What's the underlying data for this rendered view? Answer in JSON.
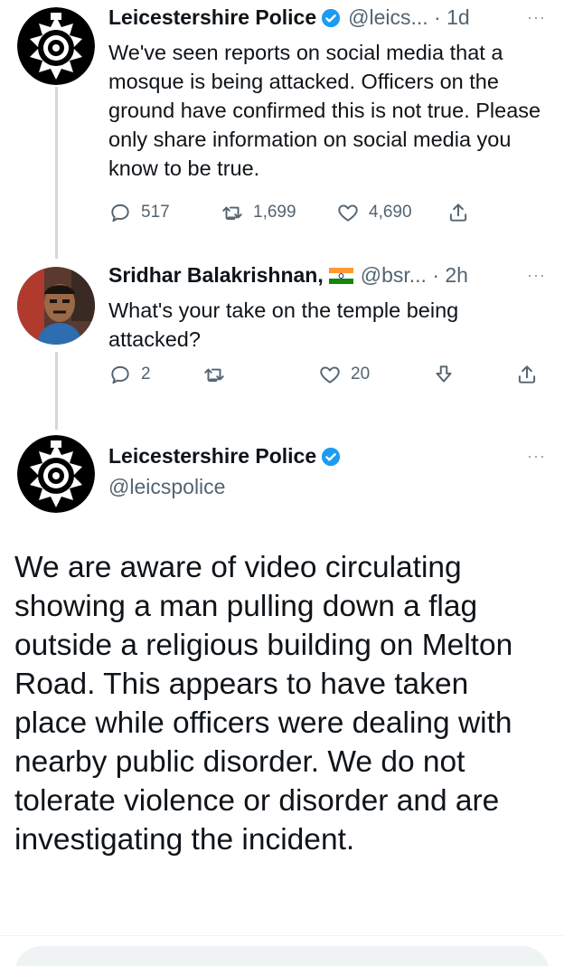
{
  "tweets": [
    {
      "name": "Leicestershire Police",
      "handle": "@leics... · 1d",
      "more": "···",
      "text": "We've seen reports on social media that a mosque is being attacked. Officers on the ground have confirmed this is not true. Please only share information on social media you know to be true.",
      "replies": "517",
      "retweets": "1,699",
      "likes": "4,690"
    },
    {
      "name": "Sridhar Balakrishnan,",
      "handle": "@bsr... · 2h",
      "more": "···",
      "text": "What's your take on the temple being attacked?",
      "replies": "2",
      "retweets": "",
      "likes": "20"
    }
  ],
  "main": {
    "name": "Leicestershire Police",
    "handle": "@leicspolice",
    "more": "···",
    "text": "We are aware of video circulating showing a man pulling down a flag outside a religious building on Melton Road. This appears to have taken place while officers were dealing with nearby public disorder. We do not tolerate violence or disorder and are investigating the incident."
  },
  "icons": {
    "verified": "verified-badge-icon",
    "reply": "reply-icon",
    "retweet": "retweet-icon",
    "like": "heart-icon",
    "share": "share-icon",
    "downvote": "downvote-icon",
    "flag": "india-flag-icon"
  },
  "colors": {
    "verified": "#1d9bf0",
    "text": "#0f1419",
    "secondary": "#536471",
    "thread_line": "#cfd9de"
  }
}
